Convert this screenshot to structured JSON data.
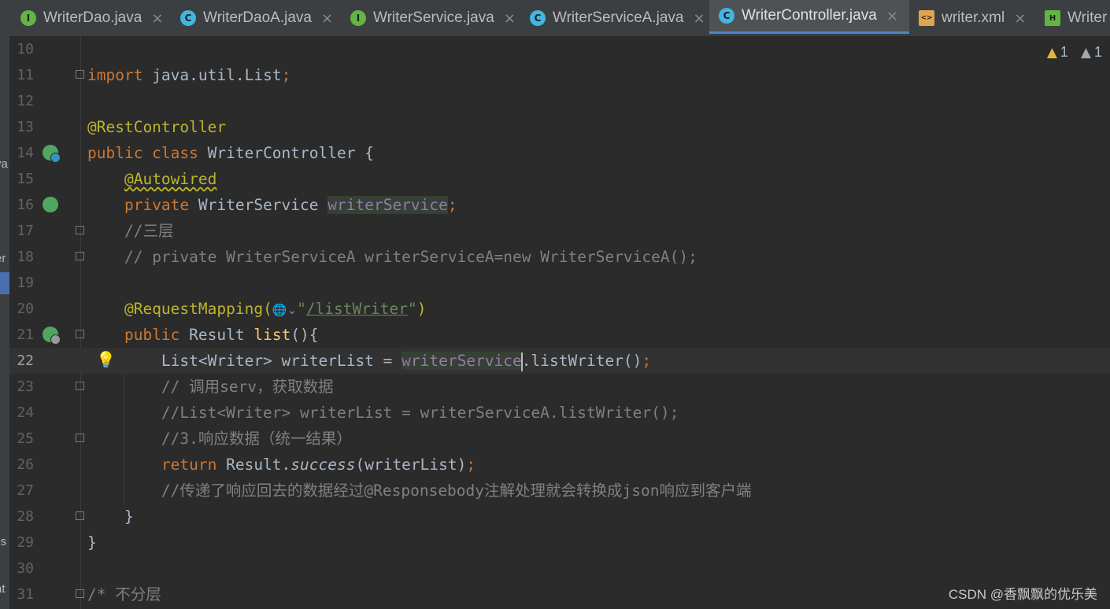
{
  "tabs": [
    {
      "label": "WriterDao.java",
      "icon": "I"
    },
    {
      "label": "WriterDaoA.java",
      "icon": "C"
    },
    {
      "label": "WriterService.java",
      "icon": "I"
    },
    {
      "label": "WriterServiceA.java",
      "icon": "C"
    },
    {
      "label": "WriterController.java",
      "icon": "C",
      "active": true
    },
    {
      "label": "writer.xml",
      "icon": "<>"
    },
    {
      "label": "Writer",
      "icon": "H"
    }
  ],
  "tab_close_glyph": "×",
  "left_fragments": [
    "va",
    "er",
    "ils",
    "at"
  ],
  "warnings": {
    "yellow": "1",
    "grey": "1"
  },
  "line_numbers": [
    "10",
    "11",
    "12",
    "13",
    "14",
    "15",
    "16",
    "17",
    "18",
    "19",
    "20",
    "21",
    "22",
    "23",
    "24",
    "25",
    "26",
    "27",
    "28",
    "29",
    "30",
    "31"
  ],
  "current_line": "22",
  "code": {
    "l11_kw": "import",
    "l11_rest": " java.util.List",
    "semicolon": ";",
    "l13_ann": "@RestController",
    "l14_kw": "public class ",
    "l14_rest": "WriterController {",
    "l15_ann": "@Autowired",
    "l16_kw": "private ",
    "l16_type": "WriterService ",
    "l16_field": "writerService",
    "l17_comment": "//三层",
    "l18_comment": "// private WriterServiceA writerServiceA=new WriterServiceA();",
    "l20_ann": "@RequestMapping(",
    "l20_globe": "🌐⌄",
    "l20_q1": "\"",
    "l20_path": "/listWriter",
    "l20_q2": "\"",
    "l20_close": ")",
    "l21_kw": "public ",
    "l21_type": "Result ",
    "l21_method": "list",
    "l21_rest": "(){",
    "l22_a": "List<Writer> writerList = ",
    "l22_field": "writerService",
    "l22_b": ".listWriter()",
    "l23_comment": "// 调用serv，获取数据",
    "l24_comment": "//List<Writer> writerList = writerServiceA.listWriter();",
    "l25_comment": "//3.响应数据（统一结果）",
    "l26_kw": "return ",
    "l26_cls": "Result.",
    "l26_method": "success",
    "l26_rest": "(writerList)",
    "l27_comment": "//传递了响应回去的数据经过@Responsebody注解处理就会转换成json响应到客户端",
    "l28_brace": "}",
    "l29_brace": "}",
    "l31_comment": "/* 不分层"
  },
  "watermark": "CSDN @香飘飘的优乐美"
}
